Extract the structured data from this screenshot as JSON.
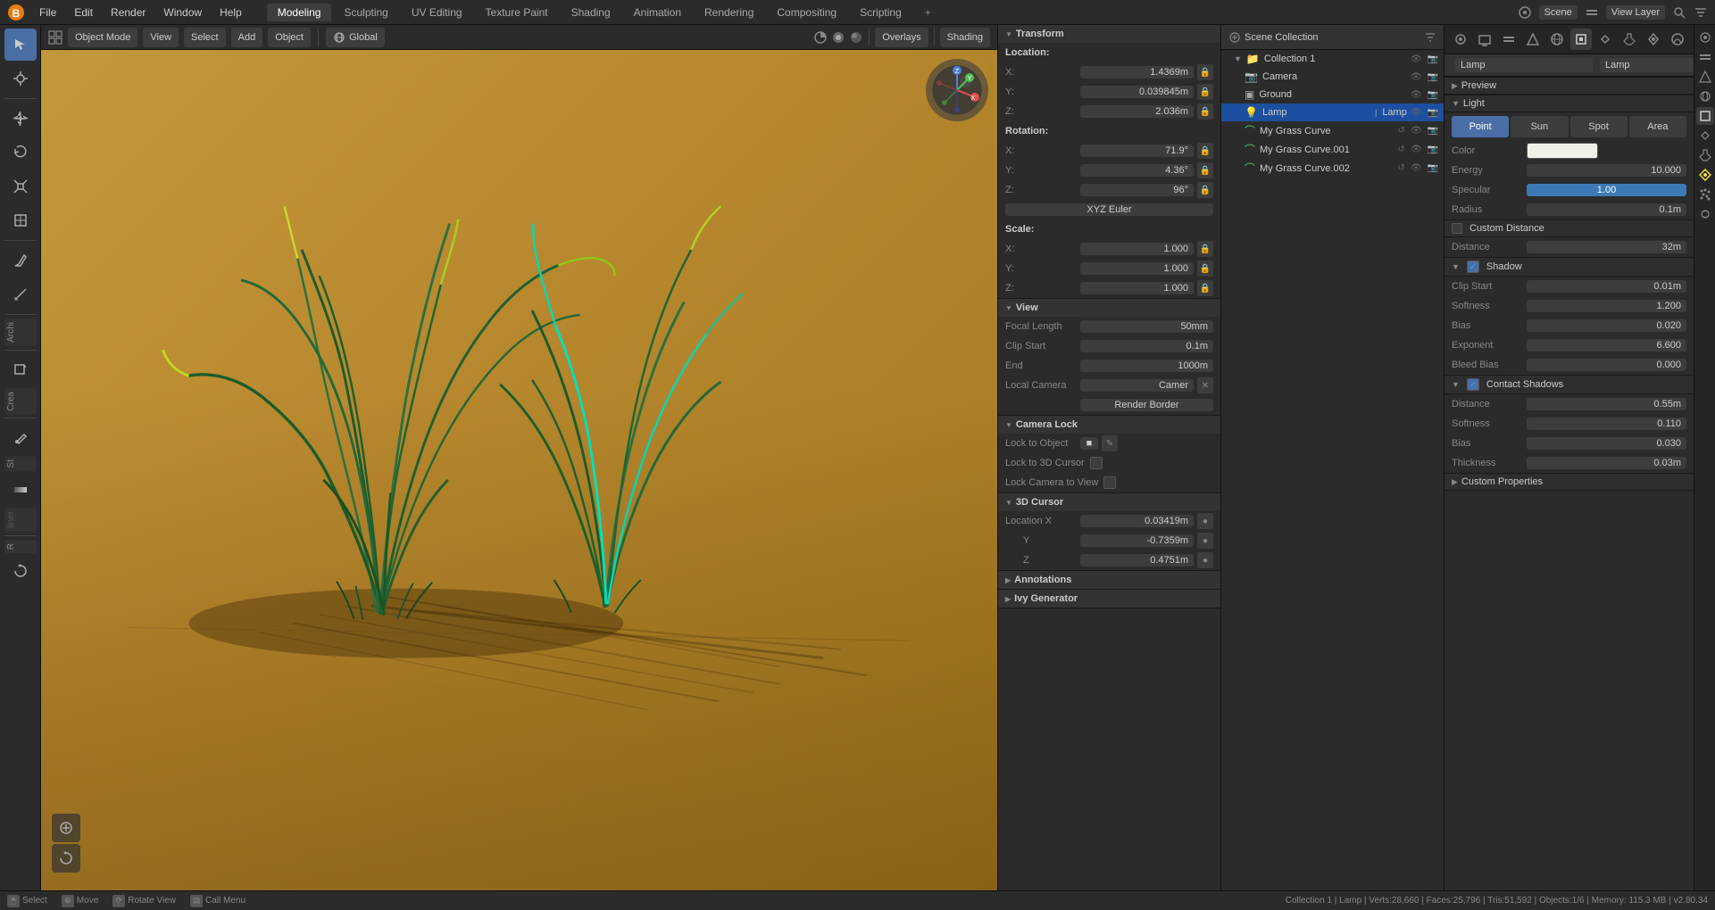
{
  "app": {
    "title": "Blender",
    "scene_name": "Scene",
    "view_layer": "View Layer"
  },
  "menu": {
    "file": "File",
    "edit": "Edit",
    "render": "Render",
    "window": "Window",
    "help": "Help"
  },
  "workspaces": [
    {
      "label": "Modeling",
      "active": true
    },
    {
      "label": "Sculpting",
      "active": false
    },
    {
      "label": "UV Editing",
      "active": false
    },
    {
      "label": "Texture Paint",
      "active": false
    },
    {
      "label": "Shading",
      "active": false
    },
    {
      "label": "Animation",
      "active": false
    },
    {
      "label": "Rendering",
      "active": false
    },
    {
      "label": "Compositing",
      "active": false
    },
    {
      "label": "Scripting",
      "active": false
    }
  ],
  "viewport_header": {
    "mode": "Object Mode",
    "view_btn": "View",
    "select_btn": "Select",
    "add_btn": "Add",
    "object_btn": "Object",
    "global": "Global",
    "overlays": "Overlays",
    "shading": "Shading"
  },
  "transform": {
    "title": "Transform",
    "location_label": "Location:",
    "x_label": "X:",
    "x_value": "1.4369m",
    "y_label": "Y:",
    "y_value": "0.039845m",
    "z_label": "Z:",
    "z_value": "2.036m",
    "rotation_label": "Rotation:",
    "rx_value": "71.9°",
    "ry_value": "4.36°",
    "rz_value": "96°",
    "rotation_mode": "XYZ Euler",
    "scale_label": "Scale:",
    "sx_value": "1.000",
    "sy_value": "1.000",
    "sz_value": "1.000"
  },
  "view_section": {
    "title": "View",
    "focal_length_label": "Focal Length",
    "focal_length_value": "50mm",
    "clip_start_label": "Clip Start",
    "clip_start_value": "0.1m",
    "end_label": "End",
    "end_value": "1000m",
    "local_camera_label": "Local Camera",
    "camera_value": "Camer",
    "render_border_label": "Render Border"
  },
  "camera_lock": {
    "title": "Camera Lock",
    "lock_to_object_label": "Lock to Object",
    "lock_to_3d_cursor_label": "Lock to 3D Cursor",
    "lock_camera_to_view_label": "Lock Camera to View"
  },
  "cursor_3d": {
    "title": "3D Cursor",
    "location_x_label": "Location X",
    "location_x_value": "0.03419m",
    "y_label": "Y",
    "y_value": "-0.7359m",
    "z_label": "Z",
    "z_value": "0.4751m"
  },
  "annotations": {
    "title": "Annotations"
  },
  "ivy_generator": {
    "title": "Ivy Generator"
  },
  "outliner": {
    "title": "Scene Collection",
    "items": [
      {
        "name": "Collection 1",
        "icon": "📁",
        "indent": 0,
        "expanded": true,
        "type": "collection"
      },
      {
        "name": "Camera",
        "icon": "📷",
        "indent": 1,
        "type": "camera"
      },
      {
        "name": "Ground",
        "icon": "⬜",
        "indent": 1,
        "type": "mesh"
      },
      {
        "name": "Lamp",
        "icon": "💡",
        "indent": 1,
        "type": "light",
        "selected": true
      },
      {
        "name": "My Grass Curve",
        "icon": "〰",
        "indent": 1,
        "type": "curve"
      },
      {
        "name": "My Grass Curve.001",
        "icon": "〰",
        "indent": 1,
        "type": "curve"
      },
      {
        "name": "My Grass Curve.002",
        "icon": "〰",
        "indent": 1,
        "type": "curve"
      }
    ]
  },
  "properties": {
    "object_name": "Lamp",
    "data_name": "Lamp",
    "preview_label": "Preview",
    "light_label": "Light",
    "light_types": [
      "Point",
      "Sun",
      "Spot",
      "Area"
    ],
    "active_light_type": "Point",
    "color_label": "Color",
    "energy_label": "Energy",
    "energy_value": "10.000",
    "specular_label": "Specular",
    "specular_value": "1.00",
    "radius_label": "Radius",
    "radius_value": "0.1m",
    "custom_distance_label": "Custom Distance",
    "distance_label": "Distance",
    "distance_value": "32m",
    "shadow_label": "Shadow",
    "shadow_enabled": true,
    "clip_start_label": "Clip Start",
    "clip_start_value": "0.01m",
    "softness_label": "Softness",
    "softness_value": "1.200",
    "bias_label": "Bias",
    "bias_value": "0.020",
    "exponent_label": "Exponent",
    "exponent_value": "6.600",
    "bleed_bias_label": "Bleed Bias",
    "bleed_bias_value": "0.000",
    "contact_shadows_label": "Contact Shadows",
    "contact_shadows_enabled": true,
    "cs_distance_label": "Distance",
    "cs_distance_value": "0.55m",
    "cs_softness_label": "Softness",
    "cs_softness_value": "0.110",
    "cs_bias_label": "Bias",
    "cs_bias_value": "0.030",
    "cs_thickness_label": "Thickness",
    "cs_thickness_value": "0.03m",
    "custom_properties_label": "Custom Properties"
  },
  "status_bar": {
    "select_label": "Select",
    "move_label": "Move",
    "rotate_label": "Rotate View",
    "call_menu_label": "Call Menu",
    "collection_info": "Collection 1 | Lamp | Verts:28,660 | Faces:25,796 | Tris:51,592 | Objects:1/6 | Memory: 115.3 MB | v2.80.34"
  },
  "icons": {
    "arrow": "▶",
    "triangle_right": "▶",
    "triangle_down": "▼",
    "lock": "🔒",
    "camera": "📷",
    "mesh": "▣",
    "light": "💡",
    "curve": "⌒",
    "eye": "👁",
    "filter": "⊞",
    "search": "🔍"
  }
}
